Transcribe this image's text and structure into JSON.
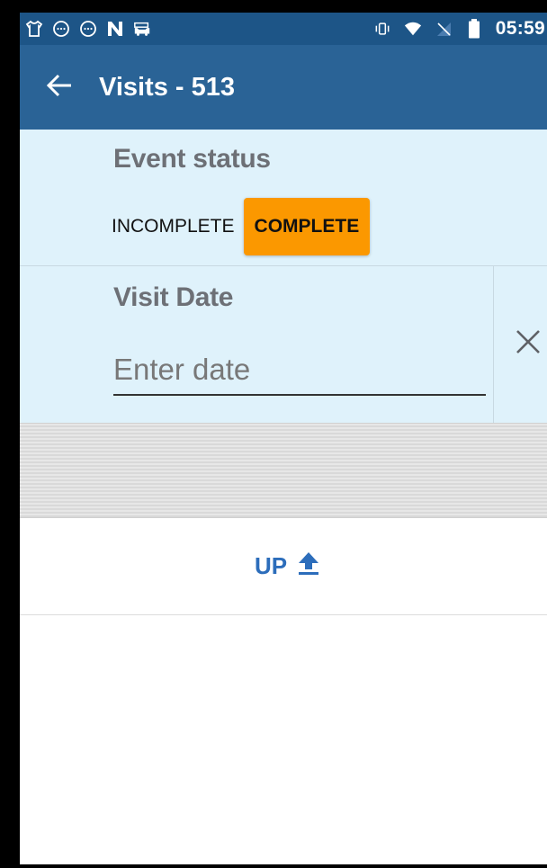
{
  "status_bar": {
    "time": "05:59",
    "left_icons": [
      "tshirt-icon",
      "message-circle-icon",
      "message-circle-icon",
      "n-logo-icon",
      "car-icon"
    ],
    "right_icons": [
      "vibrate-icon",
      "wifi-icon",
      "no-sim-icon",
      "battery-icon"
    ]
  },
  "toolbar": {
    "title": "Visits - 513",
    "back_icon": "arrow-left-icon"
  },
  "event_status": {
    "label": "Event status",
    "options": [
      "INCOMPLETE",
      "COMPLETE"
    ],
    "selected": "COMPLETE"
  },
  "visit_date": {
    "label": "Visit Date",
    "placeholder": "Enter date",
    "value": "",
    "clear_icon": "close-icon"
  },
  "up_button": {
    "label": "UP",
    "icon": "upload-icon"
  },
  "colors": {
    "status_bar": "#1d5587",
    "toolbar": "#2a6396",
    "section_bg": "#dff2fb",
    "selected_option": "#fb9800",
    "link": "#2c6dbb"
  }
}
